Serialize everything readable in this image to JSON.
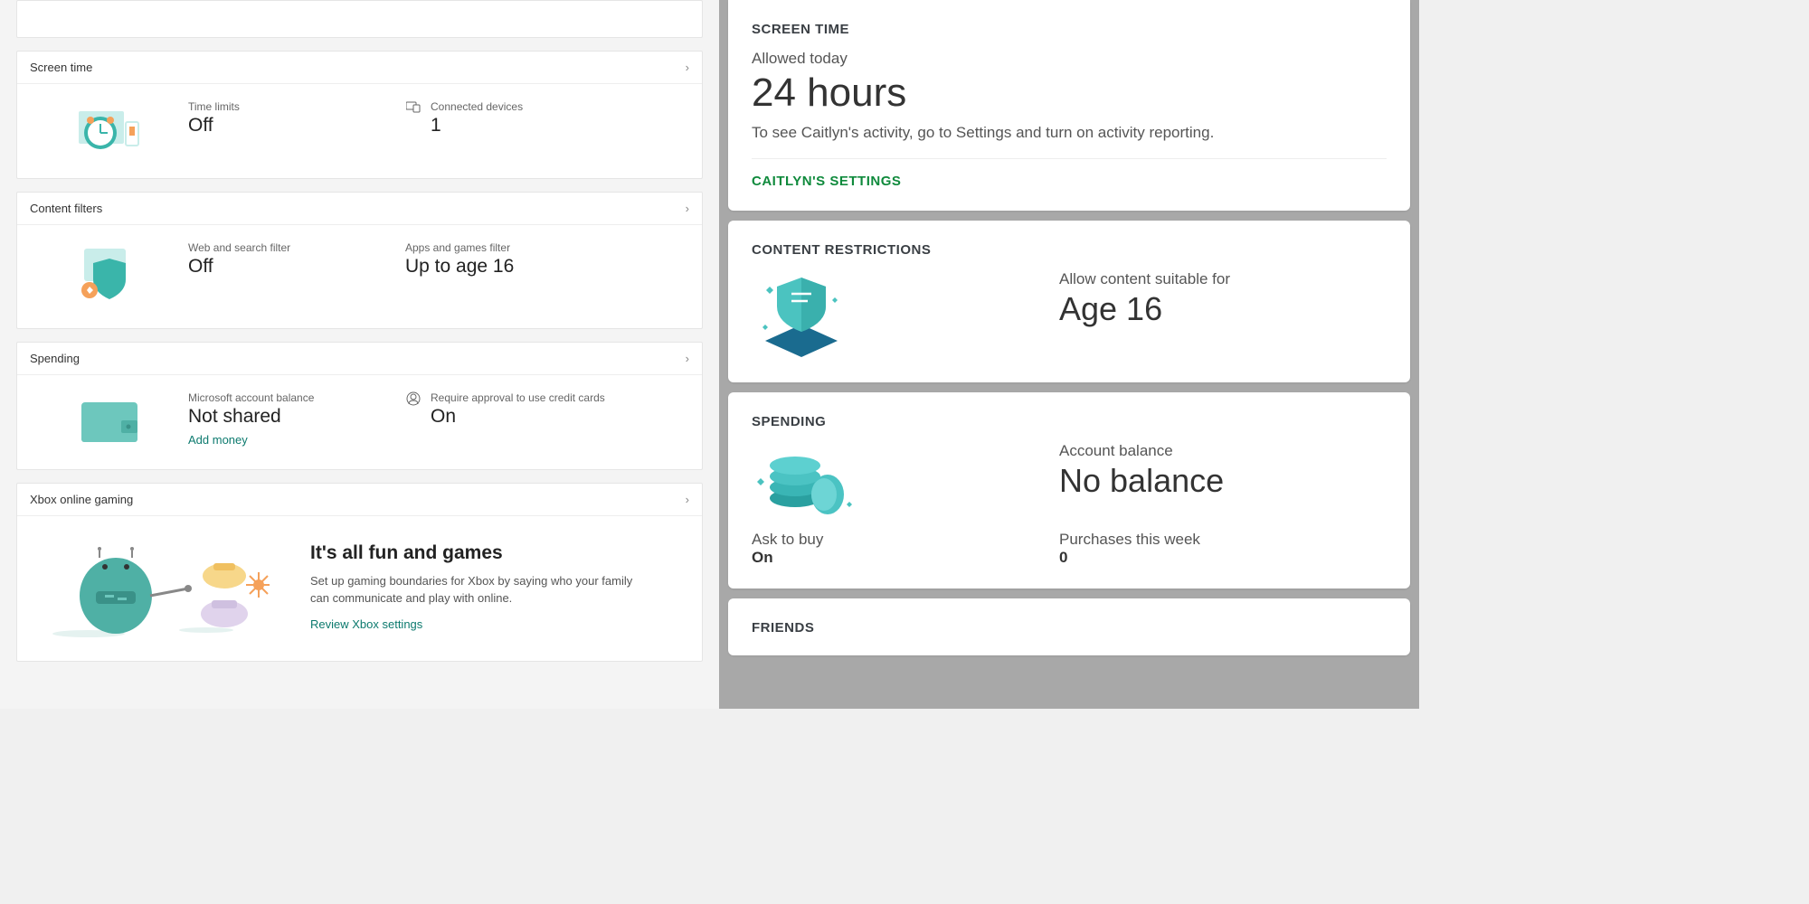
{
  "left": {
    "screenTime": {
      "title": "Screen time",
      "timeLimitsLabel": "Time limits",
      "timeLimitsValue": "Off",
      "devicesLabel": "Connected devices",
      "devicesValue": "1"
    },
    "contentFilters": {
      "title": "Content filters",
      "webFilterLabel": "Web and search filter",
      "webFilterValue": "Off",
      "appsFilterLabel": "Apps and games filter",
      "appsFilterValue": "Up to age 16"
    },
    "spending": {
      "title": "Spending",
      "balanceLabel": "Microsoft account balance",
      "balanceValue": "Not shared",
      "addMoney": "Add money",
      "approvalLabel": "Require approval to use credit cards",
      "approvalValue": "On"
    },
    "xbox": {
      "title": "Xbox online gaming",
      "headline": "It's all fun and games",
      "desc": "Set up gaming boundaries for Xbox by saying who your family can communicate and play with online.",
      "review": "Review Xbox settings"
    }
  },
  "right": {
    "screenTime": {
      "title": "SCREEN TIME",
      "allowedLabel": "Allowed today",
      "allowedValue": "24 hours",
      "desc": "To see Caitlyn's activity, go to Settings and turn on activity reporting.",
      "settingsLink": "CAITLYN'S SETTINGS"
    },
    "content": {
      "title": "CONTENT RESTRICTIONS",
      "allowLabel": "Allow content suitable for",
      "allowValue": "Age 16"
    },
    "spending": {
      "title": "SPENDING",
      "balanceLabel": "Account balance",
      "balanceValue": "No balance",
      "askLabel": "Ask to buy",
      "askValue": "On",
      "purchasesLabel": "Purchases this week",
      "purchasesValue": "0"
    },
    "friends": {
      "title": "FRIENDS"
    }
  }
}
